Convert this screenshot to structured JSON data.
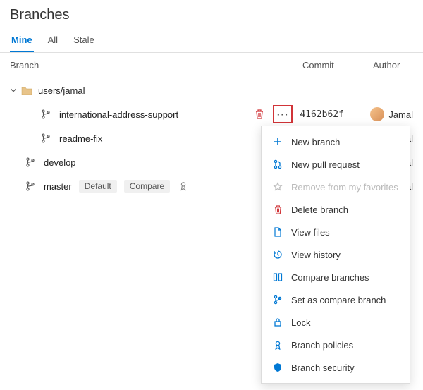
{
  "header": {
    "title": "Branches"
  },
  "tabs": {
    "mine": "Mine",
    "all": "All",
    "stale": "Stale"
  },
  "columns": {
    "branch": "Branch",
    "commit": "Commit",
    "author": "Author"
  },
  "folder": {
    "name": "users/jamal"
  },
  "rows": {
    "intl": {
      "name": "international-address-support",
      "commit": "4162b62f",
      "author": "Jamal"
    },
    "readme": {
      "name": "readme-fix",
      "author": "mal"
    },
    "develop": {
      "name": "develop",
      "author": "mal"
    },
    "master": {
      "name": "master",
      "tag_default": "Default",
      "tag_compare": "Compare",
      "author": "mal"
    }
  },
  "menu": {
    "new_branch": "New branch",
    "new_pr": "New pull request",
    "remove_fav": "Remove from my favorites",
    "delete": "Delete branch",
    "view_files": "View files",
    "history": "View history",
    "compare": "Compare branches",
    "set_compare": "Set as compare branch",
    "lock": "Lock",
    "policies": "Branch policies",
    "security": "Branch security"
  }
}
